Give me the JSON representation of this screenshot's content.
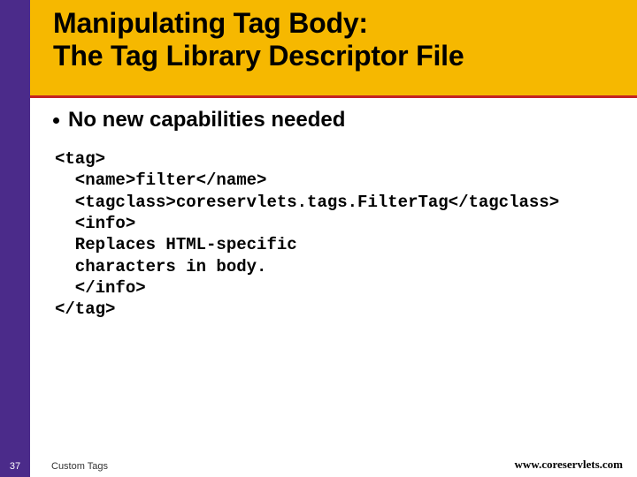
{
  "header": {
    "title_line1": "Manipulating Tag Body:",
    "title_line2": "The Tag Library Descriptor File"
  },
  "bullet": {
    "text": "No new capabilities needed"
  },
  "code": {
    "l1": "<tag>",
    "l2": "  <name>filter</name>",
    "l3": "  <tagclass>coreservlets.tags.FilterTag</tagclass>",
    "l4": "  <info>",
    "l5": "  Replaces HTML-specific",
    "l6": "  characters in body.",
    "l7": "  </info>",
    "l8": "</tag>"
  },
  "footer": {
    "page_number": "37",
    "left_label": "Custom Tags",
    "right_label": "www.coreservlets.com"
  }
}
